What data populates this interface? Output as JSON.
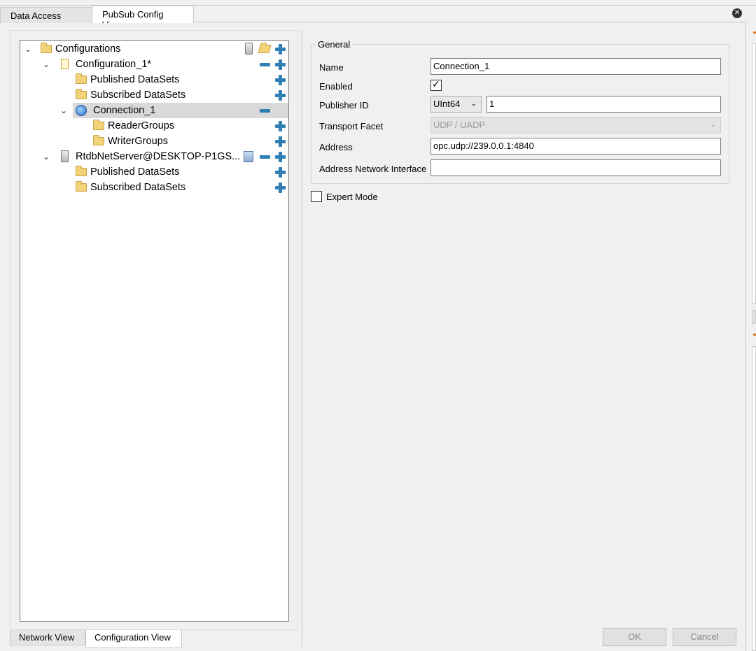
{
  "tabs": [
    {
      "label": "Data Access View",
      "active": false
    },
    {
      "label": "PubSub Config View",
      "active": true
    }
  ],
  "tree": {
    "root": {
      "label": "Configurations"
    },
    "configuration": {
      "label": "Configuration_1*"
    },
    "config_published": {
      "label": "Published DataSets"
    },
    "config_subscribed": {
      "label": "Subscribed DataSets"
    },
    "connection": {
      "label": "Connection_1"
    },
    "reader_groups": {
      "label": "ReaderGroups"
    },
    "writer_groups": {
      "label": "WriterGroups"
    },
    "server": {
      "label": "RtdbNetServer@DESKTOP-P1GS..."
    },
    "server_published": {
      "label": "Published DataSets"
    },
    "server_subscribed": {
      "label": "Subscribed DataSets"
    }
  },
  "bottom_tabs": [
    {
      "label": "Network View",
      "active": false
    },
    {
      "label": "Configuration View",
      "active": true
    }
  ],
  "form": {
    "group_title": "General",
    "name_label": "Name",
    "name_value": "Connection_1",
    "enabled_label": "Enabled",
    "enabled_checked": true,
    "publisher_id_label": "Publisher ID",
    "publisher_id_type": "UInt64",
    "publisher_id_value": "1",
    "transport_label": "Transport Facet",
    "transport_value": "UDP / UADP",
    "address_label": "Address",
    "address_value": "opc.udp://239.0.0.1:4840",
    "address_iface_label": "Address Network Interface",
    "address_iface_value": "",
    "expert_mode_label": "Expert Mode",
    "expert_mode_checked": false
  },
  "buttons": {
    "ok": "OK",
    "cancel": "Cancel"
  },
  "icons": {
    "checkmark": "✓",
    "chevron": "⌄",
    "close": "✕"
  },
  "colors": {
    "accent_blue": "#2f7fb5",
    "folder_yellow": "#f3d37a",
    "selection_gray": "#d9d9d9"
  }
}
